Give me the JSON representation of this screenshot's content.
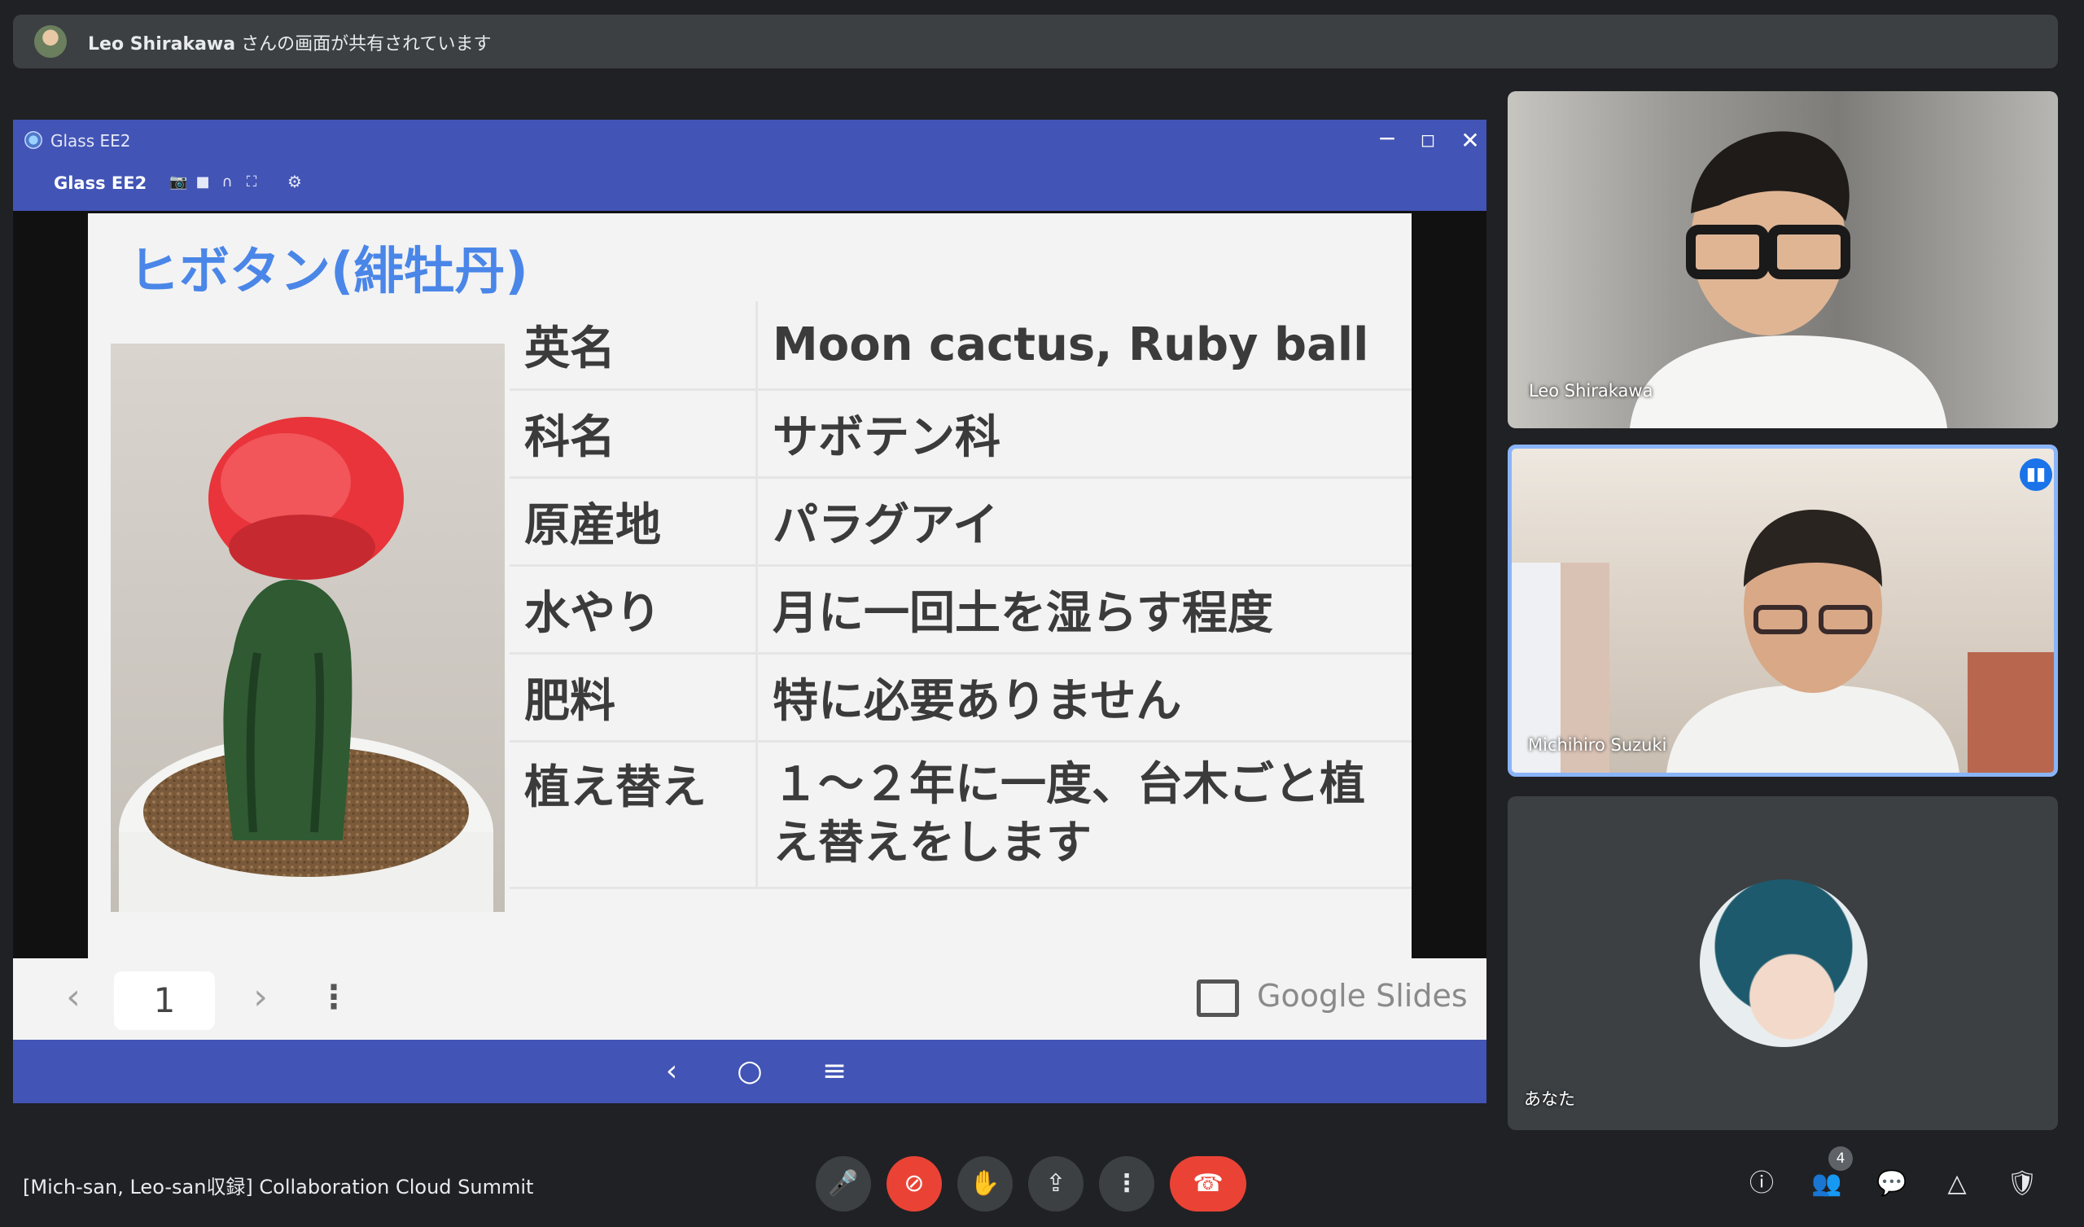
{
  "banner": {
    "presenter": "Leo Shirakawa",
    "message": " さんの画面が共有されています"
  },
  "window": {
    "title": "Glass EE2",
    "subtitle": "Glass EE2",
    "icons": {
      "minimize": "−",
      "maximize": "◻",
      "close": "✕",
      "camera": "📷",
      "video": "■",
      "headset": "∩",
      "fullscreen": "⛶",
      "settings": "⚙"
    }
  },
  "slide": {
    "title": "ヒボタン(緋牡丹)",
    "rows": [
      {
        "key": "英名",
        "value": "Moon cactus, Ruby ball"
      },
      {
        "key": "科名",
        "value": "サボテン科"
      },
      {
        "key": "原産地",
        "value": "パラグアイ"
      },
      {
        "key": "水やり",
        "value": "月に一回土を湿らす程度"
      },
      {
        "key": "肥料",
        "value": "特に必要ありません"
      },
      {
        "key": "植え替え",
        "value": "１～２年に一度、台木ごと植え替えをします"
      }
    ]
  },
  "slides_controls": {
    "page": "1",
    "brand": "Google Slides",
    "prev": "‹",
    "next": "›",
    "more": "⋮"
  },
  "android_nav": {
    "back": "‹",
    "home": "○",
    "menu": "≡"
  },
  "participants": [
    {
      "name": "Leo Shirakawa"
    },
    {
      "name": "Michihiro Suzuki"
    },
    {
      "name": "あなた"
    }
  ],
  "meeting": {
    "title": "[Mich-san, Leo-san収録] Collaboration Cloud Summit"
  },
  "controls": {
    "mic": "🎤",
    "camera": "⊘",
    "hand": "✋",
    "present": "⇪",
    "more": "⋮",
    "leave": "☎",
    "info": "ⓘ",
    "people": "👥",
    "people_count": "4",
    "chat": "💬",
    "activities": "△",
    "safety": "🛡"
  },
  "colors": {
    "window_bar": "#4254b5",
    "slide_title": "#4a86e8",
    "leave": "#ea4335",
    "speaking": "#1a73e8"
  }
}
